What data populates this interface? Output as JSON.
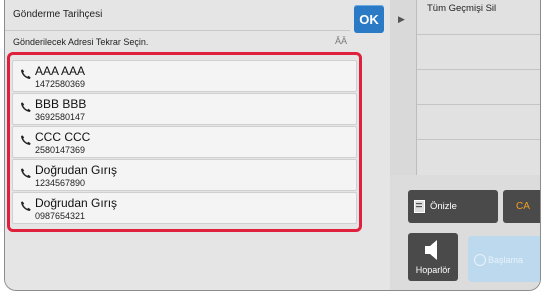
{
  "header": {
    "title": "Gönderme Tarihçesi",
    "ok_label": "OK",
    "subtitle": "Gönderilecek Adresi Tekrar Seçin.",
    "sort_glyph": "ĀÄ"
  },
  "list": [
    {
      "name": "AAA AAA",
      "number": "1472580369",
      "icon": "phone-icon"
    },
    {
      "name": "BBB BBB",
      "number": "3692580147",
      "icon": "phone-icon"
    },
    {
      "name": "CCC CCC",
      "number": "2580147369",
      "icon": "phone-icon"
    },
    {
      "name": "Doğrudan Gırış",
      "number": "1234567890",
      "icon": "phone-icon"
    },
    {
      "name": "Doğrudan Gırış",
      "number": "0987654321",
      "icon": "phone-icon"
    }
  ],
  "side": {
    "tab_arrow": "▶",
    "clear_all_label": "Tüm Geçmişi Sil"
  },
  "controls": {
    "preview_label": "Önizle",
    "ca_label": "CA",
    "speaker_label": "Hoparlör",
    "start_label": "Başlama"
  },
  "colors": {
    "ok_button": "#2b7ac6",
    "selection_border": "#e0213d",
    "ca_text": "#f0a020",
    "start_button": "#bcd9ee"
  }
}
